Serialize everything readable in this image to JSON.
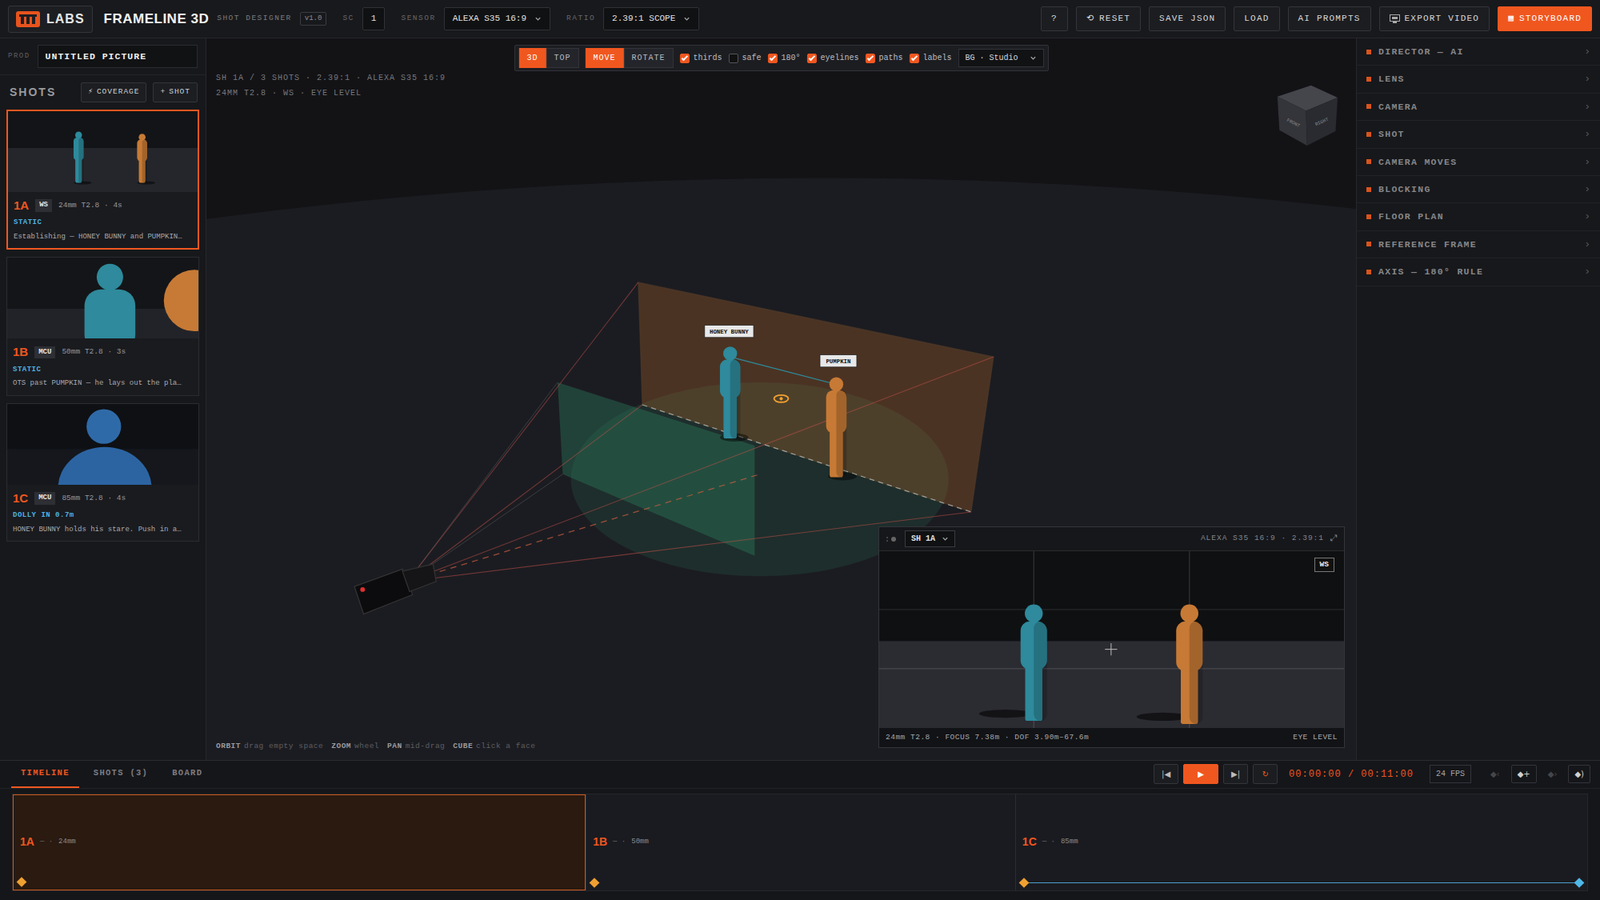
{
  "app": {
    "brand": "LABS",
    "title": "FRAMELINE 3D",
    "subtitle": "SHOT DESIGNER",
    "version": "v1.0"
  },
  "header": {
    "scene_label": "SC",
    "scene": "1",
    "sensor_label": "SENSOR",
    "sensor": "ALEXA S35 16:9",
    "ratio_label": "RATIO",
    "ratio": "2.39:1 SCOPE",
    "buttons": [
      {
        "label": "?",
        "kind": "plain"
      },
      {
        "icon": "⟲",
        "label": "RESET",
        "kind": "plain"
      },
      {
        "label": "SAVE JSON",
        "kind": "plain"
      },
      {
        "label": "LOAD",
        "kind": "plain"
      },
      {
        "label": "AI PROMPTS",
        "kind": "plain"
      },
      {
        "label": "EXPORT VIDEO",
        "kind": "video"
      },
      {
        "icon": "▦",
        "label": "STORYBOARD",
        "kind": "primary"
      }
    ]
  },
  "sidebar": {
    "prod_label": "PROD",
    "prod": "UNTITLED PICTURE",
    "title": "SHOTS",
    "actions": [
      {
        "icon": "⚡",
        "label": "COVERAGE",
        "kind": "plain"
      },
      {
        "icon": "+",
        "label": "SHOT",
        "kind": "primary"
      }
    ],
    "shots": [
      {
        "id": "1A",
        "size": "WS",
        "specs": "24mm T2.8 · 4s",
        "move": "STATIC",
        "note": "Establishing — HONEY BUNNY and PUMPKIN…",
        "selected": true,
        "kind": "wide"
      },
      {
        "id": "1B",
        "size": "MCU",
        "specs": "50mm T2.8 · 3s",
        "move": "STATIC",
        "note": "OTS past PUMPKIN — he lays out the pla…",
        "selected": false,
        "kind": "ots"
      },
      {
        "id": "1C",
        "size": "MCU",
        "specs": "85mm T2.8 · 4s",
        "move": "DOLLY IN 0.7m",
        "note": "HONEY BUNNY holds his stare. Push in a…",
        "selected": false,
        "kind": "closeup"
      }
    ]
  },
  "viewport": {
    "view": [
      {
        "label": "3D",
        "selected": true
      },
      {
        "label": "TOP",
        "selected": false
      }
    ],
    "mode": [
      {
        "label": "MOVE",
        "selected": true
      },
      {
        "label": "ROTATE",
        "selected": false
      }
    ],
    "toggles": [
      {
        "label": "thirds",
        "checked": true
      },
      {
        "label": "safe",
        "checked": false
      },
      {
        "label": "180°",
        "checked": true
      },
      {
        "label": "eyelines",
        "checked": true
      },
      {
        "label": "paths",
        "checked": true
      },
      {
        "label": "labels",
        "checked": true
      }
    ],
    "background": "BG · Studio",
    "info": [
      "SH 1A / 3 SHOTS · 2.39:1 · ALEXA S35 16:9",
      "24MM T2.8 · WS · EYE LEVEL"
    ],
    "characters": [
      {
        "name": "HONEY BUNNY",
        "color": "#2e8a9c"
      },
      {
        "name": "PUMPKIN",
        "color": "#c77a35"
      }
    ],
    "cube": [
      "FRONT",
      "RIGHT"
    ],
    "hints": [
      {
        "key": "ORBIT",
        "text": "drag empty space"
      },
      {
        "key": "ZOOM",
        "text": "wheel"
      },
      {
        "key": "PAN",
        "text": "mid-drag"
      },
      {
        "key": "CUBE",
        "text": "click a face"
      }
    ],
    "preview": {
      "shot": "SH 1A",
      "format": "ALEXA S35 16:9 · 2.39:1",
      "expand": "⤢",
      "size": "WS",
      "lens": "24mm T2.8 · FOCUS 7.38m · DOF 3.90m–67.6m",
      "angle": "EYE LEVEL"
    }
  },
  "panel": {
    "sections": [
      {
        "label": "DIRECTOR — AI",
        "chevron": "›"
      },
      {
        "label": "LENS",
        "chevron": "›"
      },
      {
        "label": "CAMERA",
        "chevron": "›"
      },
      {
        "label": "SHOT",
        "chevron": "›"
      },
      {
        "label": "CAMERA MOVES",
        "chevron": "›"
      },
      {
        "label": "BLOCKING",
        "chevron": "›"
      },
      {
        "label": "FLOOR PLAN",
        "chevron": "›"
      },
      {
        "label": "REFERENCE FRAME",
        "chevron": "›"
      },
      {
        "label": "AXIS — 180° RULE",
        "chevron": "›"
      }
    ]
  },
  "timeline": {
    "tabs": [
      {
        "label": "TIMELINE",
        "selected": true
      },
      {
        "label": "SHOTS (3)",
        "selected": false
      },
      {
        "label": "BOARD",
        "selected": false
      }
    ],
    "transport": [
      {
        "icon": "|◀",
        "kind": "plain",
        "on": false
      },
      {
        "icon": "▶",
        "kind": "primary",
        "on": false
      },
      {
        "icon": "▶|",
        "kind": "plain",
        "on": false
      },
      {
        "icon": "↻",
        "kind": "plain",
        "on": true
      }
    ],
    "time": "00:00:00 / 00:11:00",
    "fps": "24 FPS",
    "keys": [
      {
        "icon": "◆‹",
        "disabled": true
      },
      {
        "icon": "◆+",
        "disabled": false
      },
      {
        "icon": "◆›",
        "disabled": true
      },
      {
        "icon": "◆)",
        "disabled": false
      }
    ],
    "segments": [
      {
        "id": "1A",
        "sep": "— ·",
        "lens": "24mm",
        "selected": true,
        "level": 0.364,
        "path": false,
        "keyframes": [
          {
            "level": 0.0,
            "color": "#f0a030"
          }
        ]
      },
      {
        "id": "1B",
        "sep": "— ·",
        "lens": "50mm",
        "selected": false,
        "level": 0.272,
        "path": false,
        "keyframes": [
          {
            "level": 0.0,
            "color": "#f0a030"
          }
        ]
      },
      {
        "id": "1C",
        "sep": "— ·",
        "lens": "85mm",
        "selected": false,
        "level": 0.364,
        "path": true,
        "keyframes": [
          {
            "level": 0.0,
            "color": "#f0a030"
          },
          {
            "level": 1.0,
            "color": "#4fb8e8"
          }
        ]
      }
    ]
  }
}
